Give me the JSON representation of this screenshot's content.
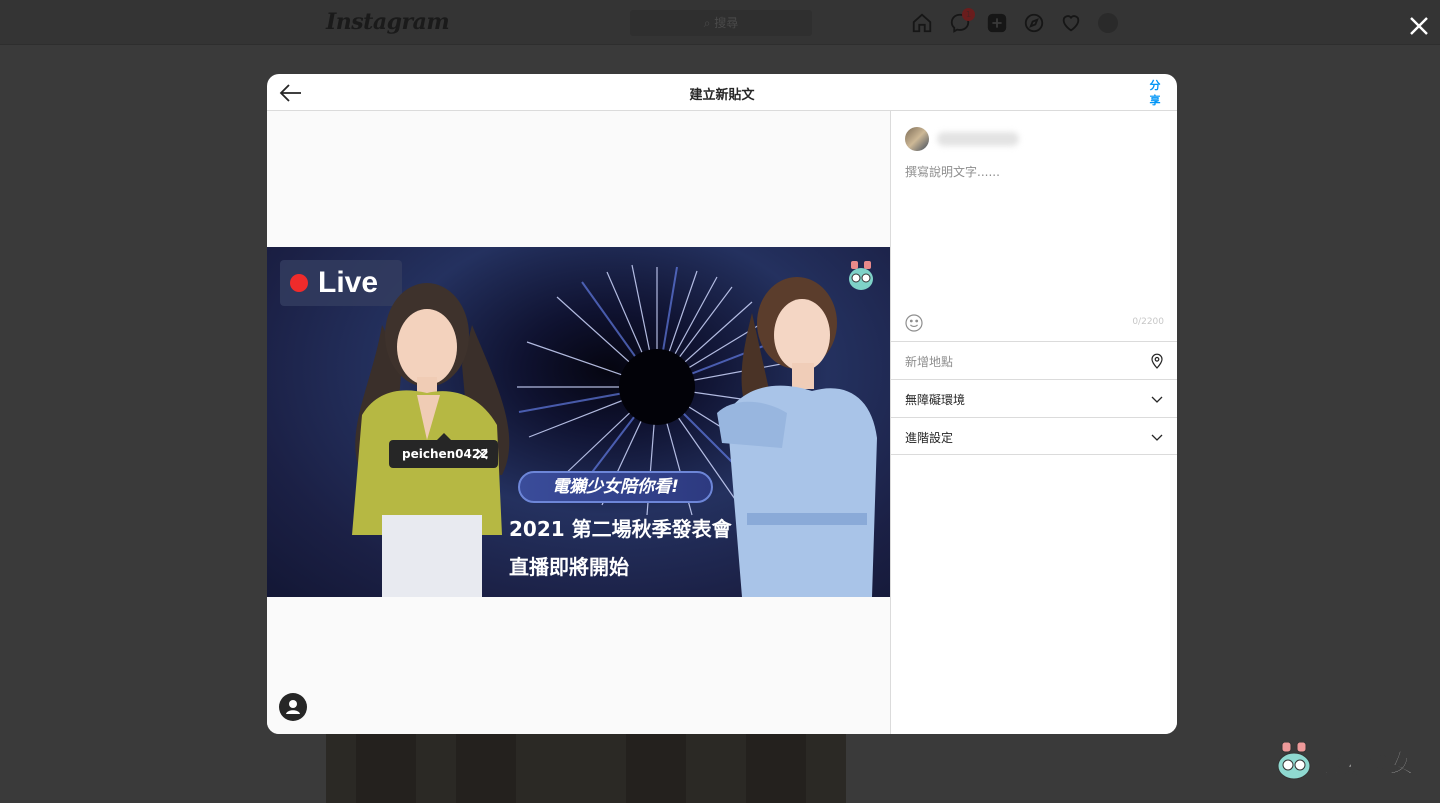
{
  "background": {
    "logo": "Instagram",
    "search_placeholder": "搜尋",
    "notification_count": "1"
  },
  "modal": {
    "title": "建立新貼文",
    "share_label": "分享",
    "image": {
      "live_label": "Live",
      "promo_pill": "電獺少女陪你看!",
      "promo_line1": "2021 第二場秋季發表會",
      "promo_line2": "直播即將開始"
    },
    "tag": {
      "username": "peichen0422"
    },
    "caption": {
      "placeholder": "撰寫說明文字......",
      "char_count": "0/2200"
    },
    "rows": {
      "location": "新增地點",
      "accessibility": "無障礙環境",
      "advanced": "進階設定"
    }
  },
  "watermark": {
    "brand": "電獺少女"
  },
  "colors": {
    "accent_blue": "#0095f6",
    "overlay": "#3a3a3a",
    "live_red": "#ef2b2b"
  }
}
